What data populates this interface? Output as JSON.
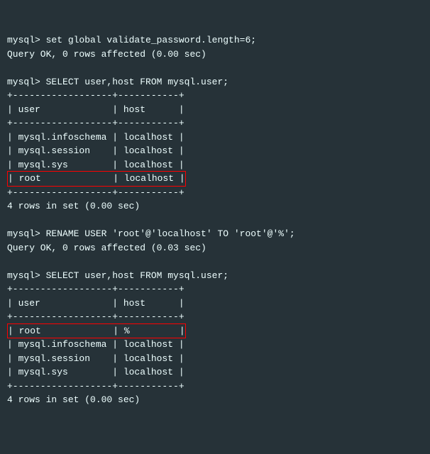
{
  "block1": {
    "prompt1": "mysql> set global validate_password.length=6;",
    "resp1": "Query OK, 0 rows affected (0.00 sec)",
    "prompt2": "mysql> SELECT user,host FROM mysql.user;",
    "sep": "+------------------+-----------+",
    "header": "| user             | host      |",
    "r1": "| mysql.infoschema | localhost |",
    "r2": "| mysql.session    | localhost |",
    "r3": "| mysql.sys        | localhost |",
    "r4": "| root             | localhost |",
    "footer": "4 rows in set (0.00 sec)"
  },
  "block2": {
    "prompt1": "mysql> RENAME USER 'root'@'localhost' TO 'root'@'%';",
    "resp1": "Query OK, 0 rows affected (0.03 sec)",
    "prompt2": "mysql> SELECT user,host FROM mysql.user;",
    "sep": "+------------------+-----------+",
    "header": "| user             | host      |",
    "r1": "| root             | %         |",
    "r2": "| mysql.infoschema | localhost |",
    "r3": "| mysql.session    | localhost |",
    "r4": "| mysql.sys        | localhost |",
    "footer": "4 rows in set (0.00 sec)"
  }
}
